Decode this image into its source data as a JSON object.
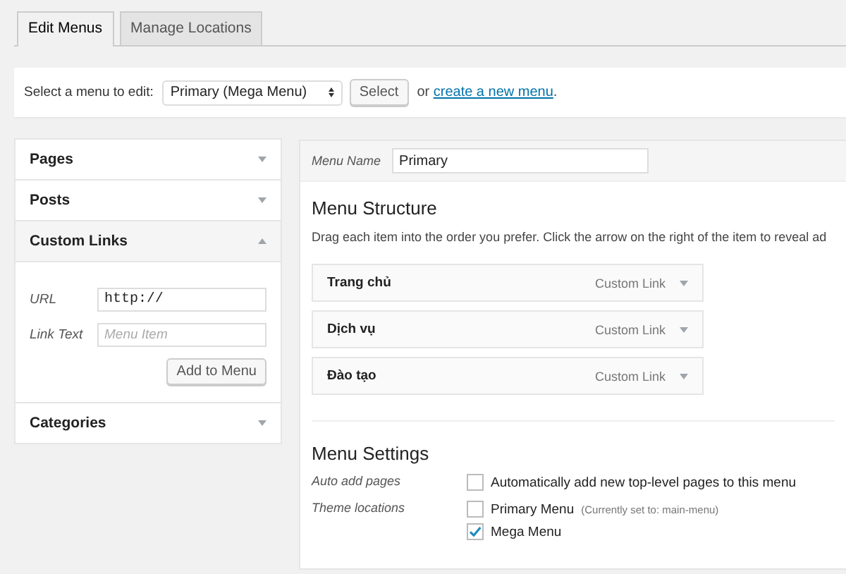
{
  "tabs": [
    {
      "label": "Edit Menus",
      "selected": true
    },
    {
      "label": "Manage Locations",
      "selected": false
    }
  ],
  "menu_select": {
    "label": "Select a menu to edit:",
    "value": "Primary (Mega Menu)",
    "button": "Select",
    "separator": "or",
    "link": "create a new menu",
    "link_end": "."
  },
  "sidebar": {
    "sections": [
      {
        "title": "Pages",
        "expanded": false
      },
      {
        "title": "Posts",
        "expanded": false
      },
      {
        "title": "Custom Links",
        "expanded": true,
        "fields": [
          {
            "label": "URL",
            "value": "http://"
          },
          {
            "label": "Link Text",
            "placeholder": "Menu Item"
          }
        ],
        "button": "Add to Menu"
      },
      {
        "title": "Categories",
        "expanded": false
      }
    ]
  },
  "menu_name": {
    "label": "Menu Name",
    "value": "Primary"
  },
  "structure": {
    "title": "Menu Structure",
    "instructions": "Drag each item into the order you prefer. Click the arrow on the right of the item to reveal ad",
    "items": [
      {
        "title": "Trang chủ",
        "type": "Custom Link"
      },
      {
        "title": "Dịch vụ",
        "type": "Custom Link"
      },
      {
        "title": "Đào tạo",
        "type": "Custom Link"
      }
    ]
  },
  "settings": {
    "title": "Menu Settings",
    "rows": [
      {
        "label": "Auto add pages",
        "options": [
          {
            "text": "Automatically add new top-level pages to this menu",
            "checked": false
          }
        ]
      },
      {
        "label": "Theme locations",
        "options": [
          {
            "text": "Primary Menu",
            "note": "(Currently set to: main-menu)",
            "checked": false
          },
          {
            "text": "Mega Menu",
            "checked": true
          }
        ]
      }
    ]
  }
}
